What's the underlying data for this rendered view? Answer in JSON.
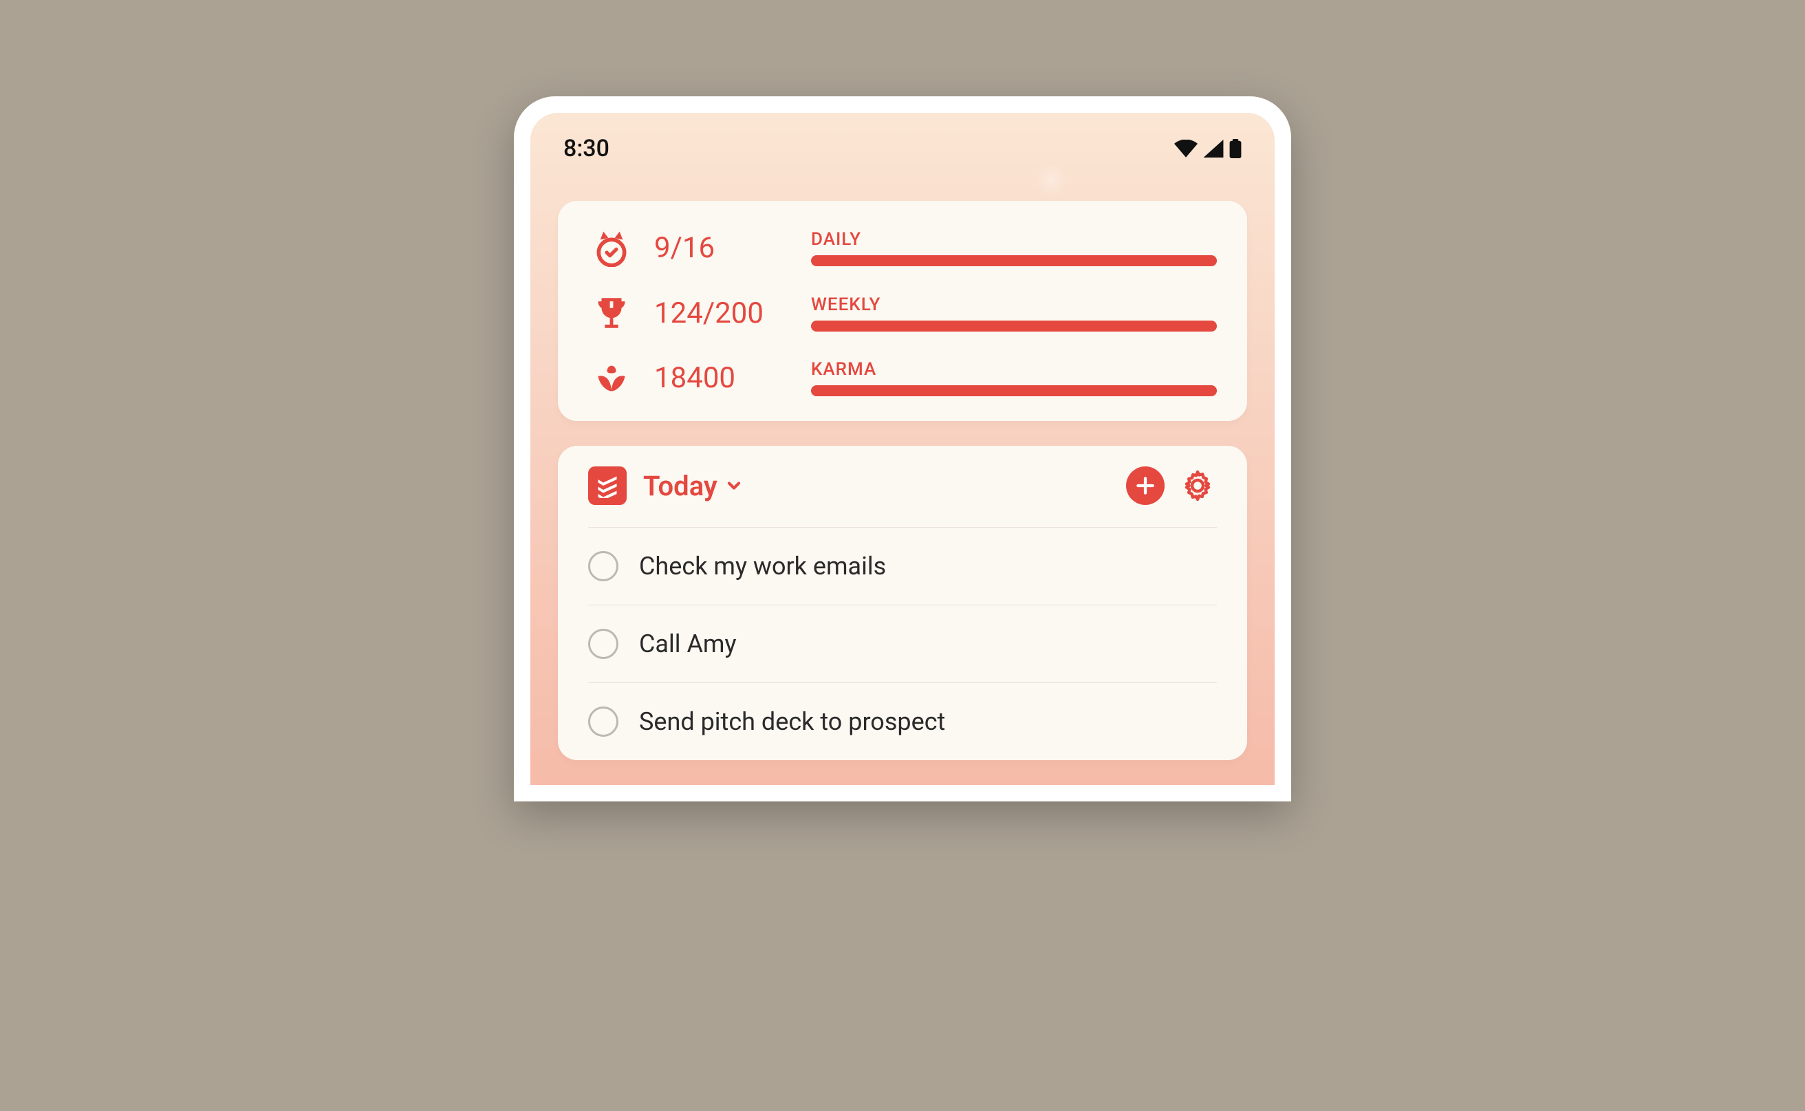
{
  "statusbar": {
    "time": "8:30"
  },
  "stats": [
    {
      "icon": "medal-icon",
      "value": "9/16",
      "label": "DAILY",
      "progress": 100
    },
    {
      "icon": "trophy-icon",
      "value": "124/200",
      "label": "WEEKLY",
      "progress": 100
    },
    {
      "icon": "plant-icon",
      "value": "18400",
      "label": "KARMA",
      "progress": 100
    }
  ],
  "tasks": {
    "view_label": "Today",
    "items": [
      {
        "title": "Check my work emails"
      },
      {
        "title": "Call Amy"
      },
      {
        "title": "Send pitch deck to prospect"
      }
    ]
  },
  "colors": {
    "accent": "#e4483f"
  }
}
